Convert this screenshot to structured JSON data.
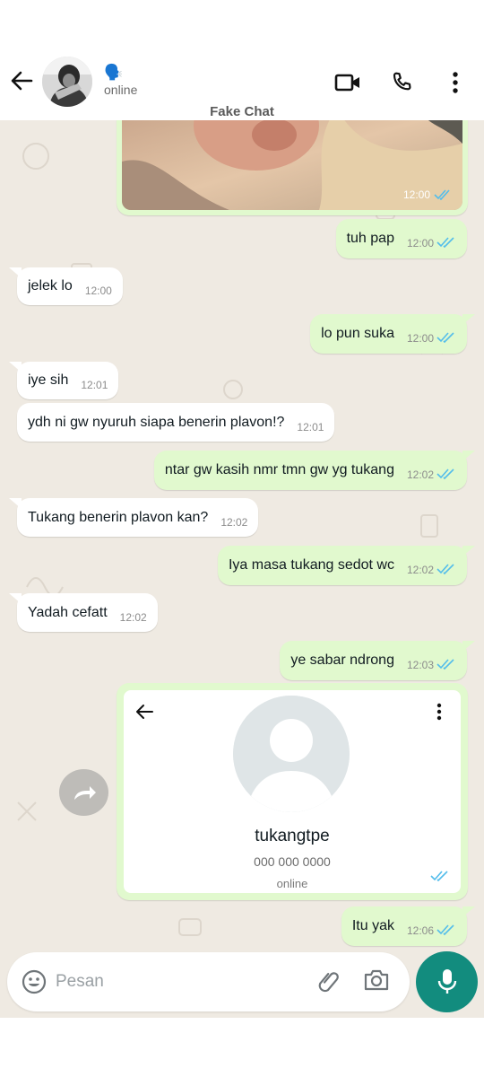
{
  "header": {
    "status": "online",
    "name_icon": "🗣️",
    "watermark": "Fake Chat"
  },
  "messages": [
    {
      "dir": "out",
      "text": "tuh pap",
      "time": "12:00",
      "read": true
    },
    {
      "dir": "in",
      "text": "jelek lo",
      "time": "12:00"
    },
    {
      "dir": "out",
      "text": "lo pun suka",
      "time": "12:00",
      "read": true
    },
    {
      "dir": "in",
      "text": "iye sih",
      "time": "12:01"
    },
    {
      "dir": "in",
      "text": "ydh ni gw nyuruh siapa benerin plavon!?",
      "time": "12:01"
    },
    {
      "dir": "out",
      "text": "ntar gw kasih nmr tmn gw yg tukang",
      "time": "12:02",
      "read": true
    },
    {
      "dir": "in",
      "text": "Tukang benerin plavon kan?",
      "time": "12:02"
    },
    {
      "dir": "out",
      "text": "Iya masa tukang sedot wc",
      "time": "12:02",
      "read": true
    },
    {
      "dir": "in",
      "text": "Yadah cefatt",
      "time": "12:02"
    },
    {
      "dir": "out",
      "text": "ye sabar ndrong",
      "time": "12:03",
      "read": true
    },
    {
      "dir": "out",
      "text": "Itu yak",
      "time": "12:06",
      "read": true
    }
  ],
  "image_message": {
    "time": "12:00",
    "read": true
  },
  "contact_card": {
    "name": "tukangtpe",
    "phone": "000 000 0000",
    "status": "online"
  },
  "input": {
    "placeholder": "Pesan"
  },
  "colors": {
    "chat_bg": "#efeae2",
    "out_bubble": "#e1f9ce",
    "in_bubble": "#ffffff",
    "read_tick": "#53bdeb",
    "accent": "#128c7e"
  },
  "icons": [
    "back-arrow-icon",
    "video-call-icon",
    "phone-icon",
    "more-vert-icon",
    "emoji-icon",
    "attach-icon",
    "camera-icon",
    "mic-icon",
    "forward-icon"
  ]
}
